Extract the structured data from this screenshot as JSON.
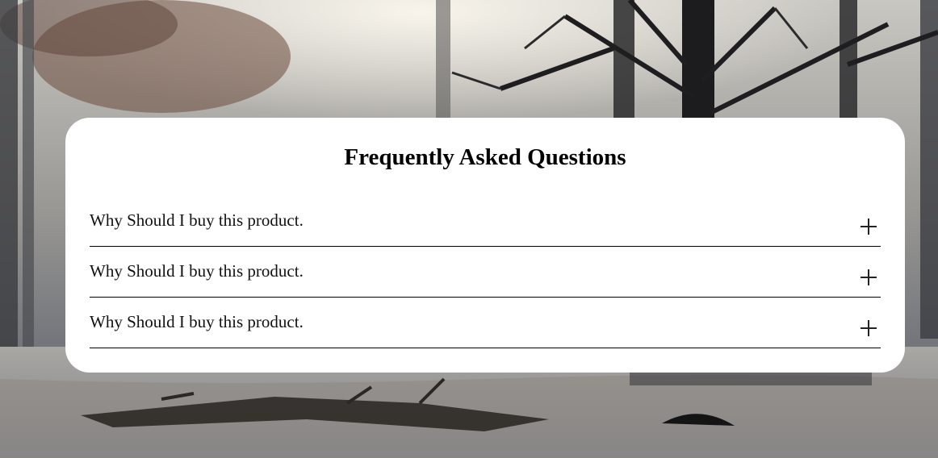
{
  "faq": {
    "title": "Frequently Asked Questions",
    "items": [
      {
        "question": "Why Should I buy this product.",
        "icon": "plus-icon"
      },
      {
        "question": "Why Should I buy this product.",
        "icon": "plus-icon"
      },
      {
        "question": "Why Should I buy this product.",
        "icon": "plus-icon"
      }
    ]
  },
  "colors": {
    "card_background": "#ffffff",
    "text": "#000000",
    "divider": "#000000"
  }
}
